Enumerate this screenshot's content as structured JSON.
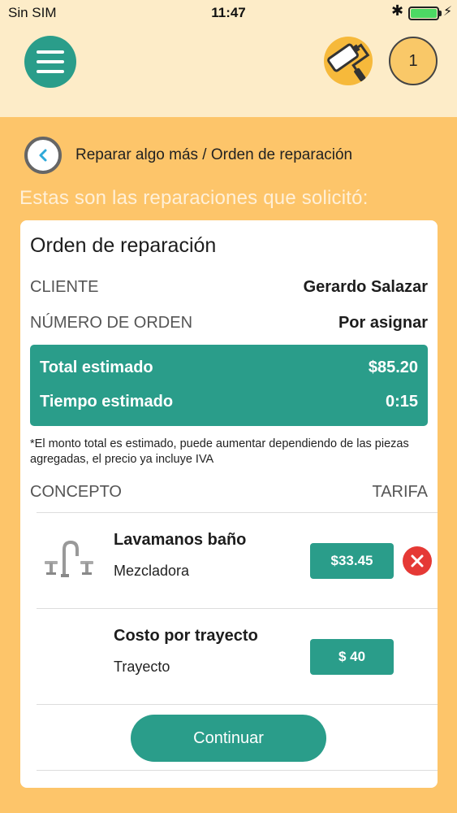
{
  "status_bar": {
    "carrier": "Sin SIM",
    "time": "11:47",
    "bluetooth_icon": "bluetooth-icon",
    "battery_icon": "battery-icon",
    "battery_level": 1.0
  },
  "header": {
    "menu_icon": "hamburger-menu-icon",
    "tool_icon": "paint-roller-icon",
    "cart_count": "1"
  },
  "breadcrumb": "Reparar algo más / Orden de reparación",
  "intro": "Estas son las reparaciones que solicitó:",
  "order": {
    "title": "Orden de reparación",
    "client_label": "CLIENTE",
    "client_value": "Gerardo Salazar",
    "order_number_label": "NÚMERO DE ORDEN",
    "order_number_value": "Por asignar",
    "total_label": "Total estimado",
    "total_value": "$85.20",
    "time_label": "Tiempo estimado",
    "time_value": "0:15",
    "note": "*El monto total es estimado, puede aumentar dependiendo de las piezas agregadas, el precio ya incluye IVA",
    "concept_header": "CONCEPTO",
    "rate_header": "TARIFA",
    "items": [
      {
        "title": "Lavamanos baño",
        "subtitle": "Mezcladora",
        "price": "$33.45",
        "icon": "faucet-icon",
        "removable": true
      },
      {
        "title": "Costo por trayecto",
        "subtitle": "Trayecto",
        "price": "$ 40",
        "removable": false
      }
    ],
    "continue_label": "Continuar"
  },
  "colors": {
    "accent": "#2a9d8a",
    "background": "#fdc56a",
    "header_bg": "#fdecc8",
    "remove": "#e53935"
  }
}
